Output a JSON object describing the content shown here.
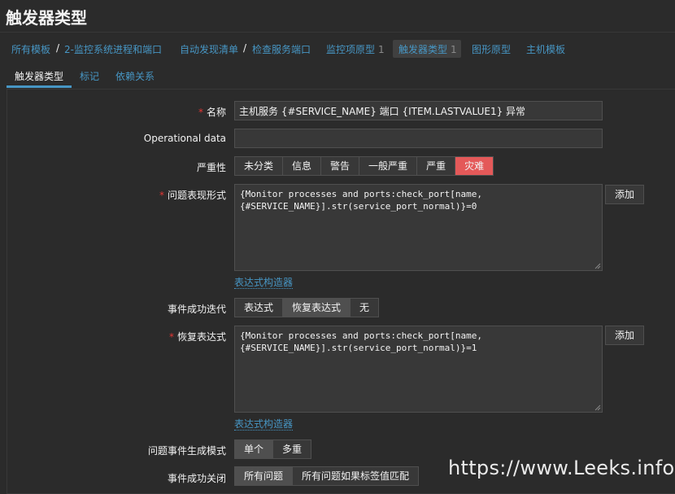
{
  "page_title": "触发器类型",
  "breadcrumb": {
    "items": [
      {
        "label": "所有模板"
      },
      {
        "label": "2-监控系统进程和端口"
      },
      {
        "label": "自动发现清单"
      },
      {
        "label": "检查服务端口"
      },
      {
        "label": "监控项原型",
        "count": "1"
      },
      {
        "label": "触发器类型",
        "count": "1",
        "active": true
      },
      {
        "label": "图形原型"
      },
      {
        "label": "主机模板"
      }
    ],
    "separator": "/"
  },
  "tabs": [
    {
      "label": "触发器类型",
      "active": true
    },
    {
      "label": "标记"
    },
    {
      "label": "依赖关系"
    }
  ],
  "form": {
    "name": {
      "label": "名称",
      "required": true,
      "value": "主机服务 {#SERVICE_NAME} 端口 {ITEM.LASTVALUE1} 异常"
    },
    "operational_data": {
      "label": "Operational data",
      "value": ""
    },
    "severity": {
      "label": "严重性",
      "options": [
        "未分类",
        "信息",
        "警告",
        "一般严重",
        "严重",
        "灾难"
      ],
      "selected": "灾难"
    },
    "problem_expression": {
      "label": "问题表现形式",
      "required": true,
      "line1": "{Monitor processes and ports:check_port[name,",
      "line2": "{#SERVICE_NAME}].str(service_port_normal)}=0",
      "add_label": "添加",
      "builder_link": "表达式构造器"
    },
    "ok_event_generation": {
      "label": "事件成功迭代",
      "options": [
        "表达式",
        "恢复表达式",
        "无"
      ],
      "selected": "恢复表达式"
    },
    "recovery_expression": {
      "label": "恢复表达式",
      "required": true,
      "line1": "{Monitor processes and ports:check_port[name,",
      "line2": "{#SERVICE_NAME}].str(service_port_normal)}=1",
      "add_label": "添加",
      "builder_link": "表达式构造器"
    },
    "problem_event_mode": {
      "label": "问题事件生成模式",
      "options": [
        "单个",
        "多重"
      ],
      "selected": "单个"
    },
    "ok_event_closes": {
      "label": "事件成功关闭",
      "options": [
        "所有问题",
        "所有问题如果标签值匹配"
      ],
      "selected": "所有问题"
    }
  },
  "watermark": "https://www.Leeks.info",
  "colors": {
    "background": "#2b2b2b",
    "link": "#4796c4",
    "disaster": "#e45959",
    "required": "#e33734"
  }
}
